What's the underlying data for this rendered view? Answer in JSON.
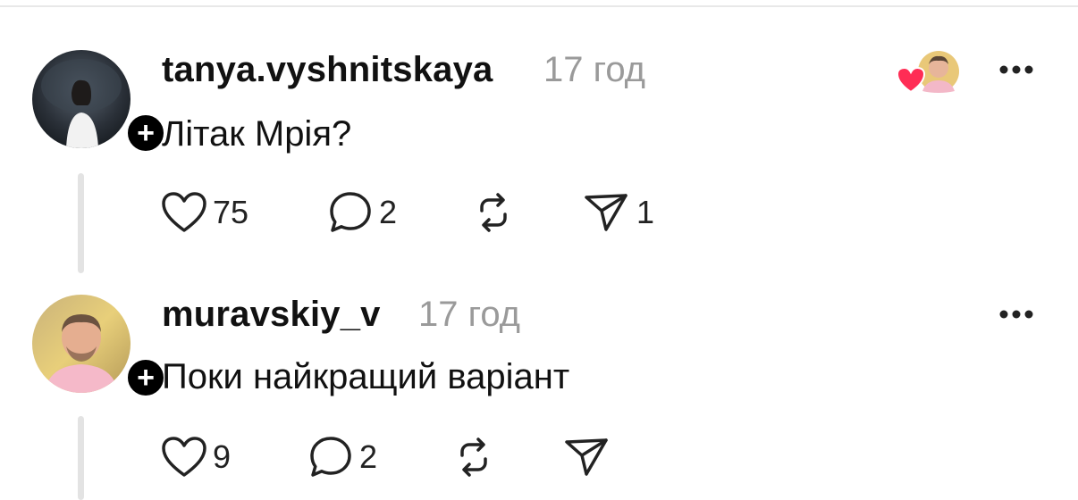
{
  "posts": [
    {
      "username": "tanya.vyshnitskaya",
      "time": "17 год",
      "text": "Літак Мрія?",
      "likes": "75",
      "comments": "2",
      "reposts": "",
      "shares": "1",
      "liked_by_author": true
    },
    {
      "username": "muravskiy_v",
      "time": "17 год",
      "text": "Поки найкращий варіант",
      "likes": "9",
      "comments": "2",
      "reposts": "",
      "shares": ""
    }
  ],
  "follow_badge_label": "+",
  "colors": {
    "heart_red": "#ff2d55",
    "muted_text": "#9a9a9a",
    "badge_black": "#000000"
  },
  "icons": [
    "heart-icon",
    "comment-icon",
    "repost-icon",
    "share-icon",
    "more-icon",
    "plus-icon"
  ]
}
